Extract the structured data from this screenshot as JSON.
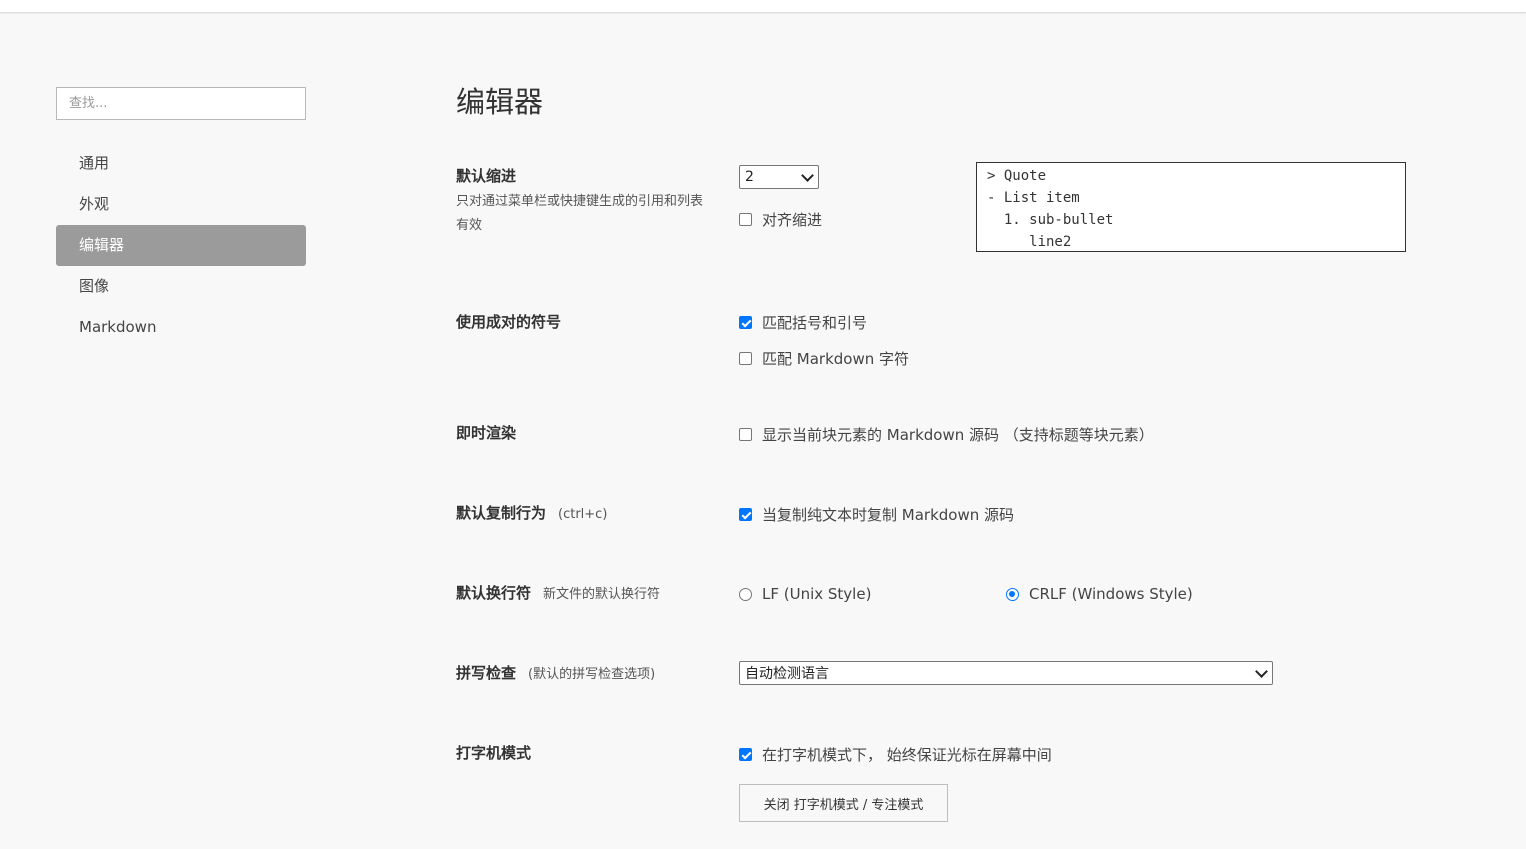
{
  "search": {
    "placeholder": "查找..."
  },
  "sidebar": {
    "items": [
      {
        "label": "通用"
      },
      {
        "label": "外观"
      },
      {
        "label": "编辑器",
        "active": true
      },
      {
        "label": "图像"
      },
      {
        "label": "Markdown"
      }
    ]
  },
  "page": {
    "title": "编辑器"
  },
  "indent": {
    "label": "默认缩进",
    "desc": "只对通过菜单栏或快捷键生成的引用和列表有效",
    "select_value": "2",
    "align_label": "对齐缩进",
    "align_checked": false,
    "preview_lines": [
      "> Quote",
      "- List item",
      "  1. sub-bullet",
      "     line2"
    ]
  },
  "pairs": {
    "label": "使用成对的符号",
    "opt1": "匹配括号和引号",
    "opt1_checked": true,
    "opt2": "匹配 Markdown 字符",
    "opt2_checked": false
  },
  "live": {
    "label": "即时渲染",
    "opt": "显示当前块元素的 Markdown 源码 （支持标题等块元素）",
    "opt_checked": false
  },
  "copy": {
    "label": "默认复制行为",
    "sub": "(ctrl+c)",
    "opt": "当复制纯文本时复制 Markdown 源码",
    "opt_checked": true
  },
  "eol": {
    "label": "默认换行符",
    "sub": "新文件的默认换行符",
    "opt_lf": "LF (Unix Style)",
    "opt_crlf": "CRLF (Windows Style)",
    "selected": "crlf"
  },
  "spell": {
    "label": "拼写检查",
    "sub": "(默认的拼写检查选项)",
    "select_value": "自动检测语言"
  },
  "typewriter": {
    "label": "打字机模式",
    "opt": "在打字机模式下， 始终保证光标在屏幕中间",
    "opt_checked": true,
    "button": "关闭 打字机模式 / 专注模式"
  },
  "colors": {
    "accent": "#0075ff",
    "active_nav_bg": "#9b9b9b",
    "background": "#f8f8f8"
  }
}
